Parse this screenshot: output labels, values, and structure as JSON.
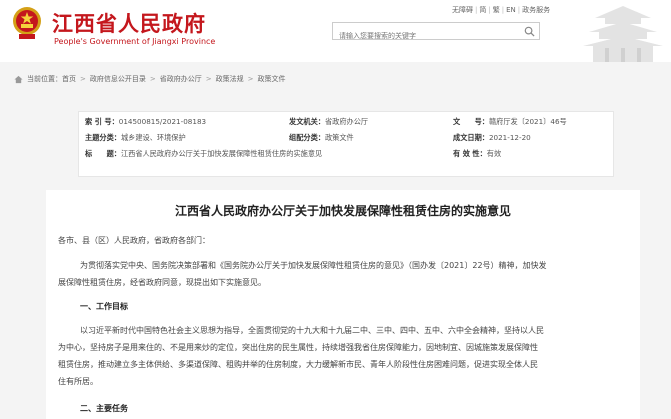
{
  "header": {
    "title": "江西省人民政府",
    "subtitle": "People's Government of Jiangxi Province",
    "links": [
      "无障碍",
      "简",
      "繁",
      "EN",
      "政务服务"
    ],
    "search_placeholder": "请输入您要搜索的关键字",
    "colors": {
      "brand": "#c4171d"
    }
  },
  "breadcrumb": {
    "prefix": "当前位置：",
    "items": [
      "首页",
      "政府信息公开目录",
      "省政府办公厅",
      "政策法规",
      "政策文件"
    ]
  },
  "meta": {
    "index_label": "索 引 号：",
    "index_value": "014500815/2021-08183",
    "issuer_label": "发文机关：",
    "issuer_value": "省政府办公厅",
    "docno_label": "文　　号：",
    "docno_value": "赣府厅发〔2021〕46号",
    "subject_label": "主题分类：",
    "subject_value": "城乡建设、环境保护",
    "category_label": "组配分类：",
    "category_value": "政策文件",
    "date_label": "成文日期：",
    "date_value": "2021-12-20",
    "title_label": "标　　题：",
    "title_value": "江西省人民政府办公厅关于加快发展保障性租赁住房的实施意见",
    "validity_label": "有 效 性：",
    "validity_value": "有效"
  },
  "doc": {
    "title": "江西省人民政府办公厅关于加快发展保障性租赁住房的实施意见",
    "salutation": "各市、县（区）人民政府，省政府各部门：",
    "intro_1": "为贯彻落实党中央、国务院决策部署和《国务院办公厅关于加快发展保障性租赁住房的意见》（国办发〔2021〕22号）精神，加快发",
    "intro_2": "展保障性租赁住房，经省政府同意，现提出如下实施意见。",
    "section_1": "一、工作目标",
    "body_1": "以习近平新时代中国特色社会主义思想为指导，全面贯彻党的十九大和十九届二中、三中、四中、五中、六中全会精神，坚持以人民",
    "body_2": "为中心，坚持房子是用来住的、不是用来炒的定位，突出住房的民生属性，持续增强我省住房保障能力，因地制宜、因城施策发展保障性",
    "body_3": "租赁住房，推动建立多主体供给、多渠道保障、租购并举的住房制度，大力缓解新市民、青年人阶段性住房困难问题，促进实现全体人民",
    "body_4": "住有所居。",
    "section_2": "二、主要任务"
  }
}
